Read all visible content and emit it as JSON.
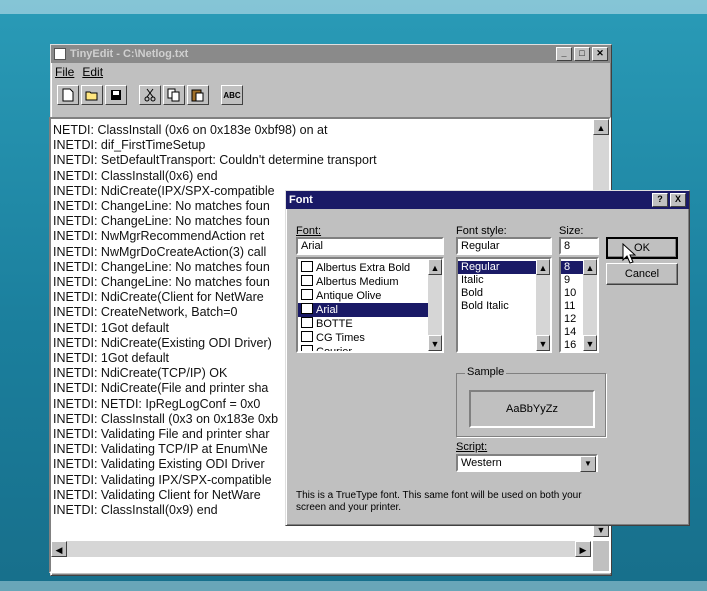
{
  "editor_window": {
    "title": "TinyEdit - C:\\Netlog.txt",
    "menu": [
      "File",
      "Edit"
    ],
    "toolbar": [
      {
        "icon": "new-file-icon"
      },
      {
        "icon": "open-folder-icon"
      },
      {
        "icon": "save-disk-icon"
      },
      {
        "icon": "cut-scissors-icon"
      },
      {
        "icon": "copy-icon"
      },
      {
        "icon": "paste-icon"
      },
      {
        "icon": "font-abc-icon",
        "label": "ABC"
      }
    ],
    "lines": [
      "NETDI: ClassInstall (0x6 on 0x183e 0xbf98) on  at",
      "INETDI: dif_FirstTimeSetup",
      "INETDI: SetDefaultTransport: Couldn't determine transport",
      "INETDI: ClassInstall(0x6) end",
      "INETDI: NdiCreate(IPX/SPX-compatible",
      "INETDI: ChangeLine: No matches foun",
      "INETDI: ChangeLine: No matches foun",
      "INETDI: NwMgrRecommendAction ret",
      "INETDI: NwMgrDoCreateAction(3) call",
      "INETDI: ChangeLine: No matches foun",
      "INETDI: ChangeLine: No matches foun",
      "INETDI: NdiCreate(Client for NetWare",
      "INETDI: CreateNetwork, Batch=0",
      "INETDI: 1Got default",
      "INETDI: NdiCreate(Existing ODI Driver)",
      "INETDI: 1Got default",
      "INETDI: NdiCreate(TCP/IP) OK",
      "INETDI: NdiCreate(File and printer sha",
      "INETDI: NETDI: IpRegLogConf = 0x0",
      "INETDI: ClassInstall (0x3 on 0x183e 0xb",
      "INETDI: Validating File and printer shar",
      "INETDI: Validating TCP/IP at Enum\\Ne",
      "INETDI: Validating Existing ODI Driver",
      "INETDI: Validating IPX/SPX-compatible",
      "INETDI: Validating Client for NetWare",
      "INETDI: ClassInstall(0x9) end"
    ]
  },
  "font_dialog": {
    "title": "Font",
    "help_button": "?",
    "close_button": "X",
    "font_label": "Font:",
    "font_value": "Arial",
    "style_label": "Font style:",
    "style_value": "Regular",
    "size_label": "Size:",
    "size_value": "8",
    "fonts": [
      "Albertus Extra Bold",
      "Albertus Medium",
      "Antique Olive",
      "Arial",
      "BOTTE",
      "CG Times",
      "Courier"
    ],
    "selected_font_index": 3,
    "styles": [
      "Regular",
      "Italic",
      "Bold",
      "Bold Italic"
    ],
    "selected_style_index": 0,
    "sizes": [
      "8",
      "9",
      "10",
      "11",
      "12",
      "14",
      "16"
    ],
    "selected_size_index": 0,
    "ok": "OK",
    "cancel": "Cancel",
    "sample_label": "Sample",
    "sample_text": "AaBbYyZz",
    "script_label": "Script:",
    "script_value": "Western",
    "note": "This is a TrueType font. This same font will be used on both your screen and your printer."
  }
}
